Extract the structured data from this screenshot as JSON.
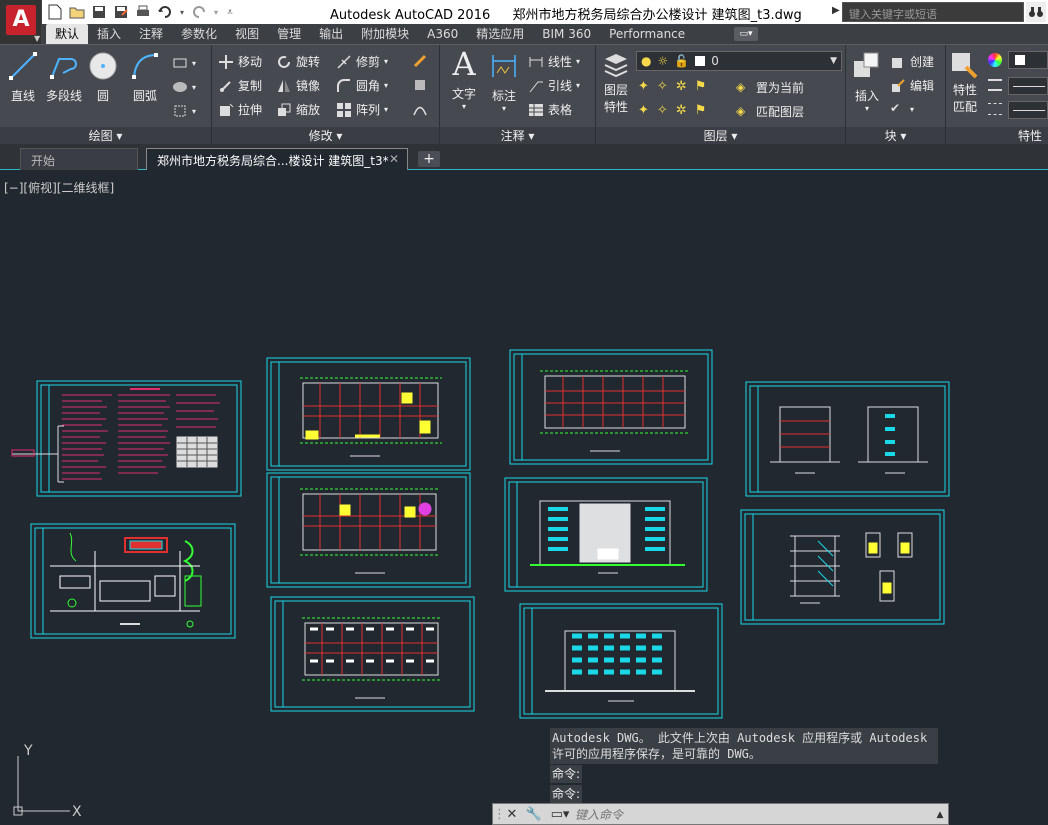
{
  "title_bar": {
    "app_title": "Autodesk AutoCAD 2016",
    "file_title": "郑州市地方税务局综合办公楼设计 建筑图_t3.dwg",
    "search_placeholder": "键入关键字或短语"
  },
  "ribbon_tabs": [
    "默认",
    "插入",
    "注释",
    "参数化",
    "视图",
    "管理",
    "输出",
    "附加模块",
    "A360",
    "精选应用",
    "BIM 360",
    "Performance"
  ],
  "active_tab": "默认",
  "panels": {
    "draw": {
      "title": "绘图",
      "tools": [
        "直线",
        "多段线",
        "圆",
        "圆弧"
      ]
    },
    "modify": {
      "title": "修改",
      "tools": [
        "移动",
        "旋转",
        "修剪",
        "复制",
        "镜像",
        "圆角",
        "拉伸",
        "缩放",
        "阵列"
      ]
    },
    "annotation": {
      "title": "注释",
      "big_tools": [
        "文字",
        "标注"
      ],
      "small_tools": [
        "线性",
        "引线",
        "表格"
      ]
    },
    "layers": {
      "title": "图层",
      "big_tool": "图层特性",
      "big_tool_line1": "图层",
      "big_tool_line2": "特性",
      "layer_current": "0",
      "actions": [
        "置为当前",
        "匹配图层"
      ]
    },
    "block": {
      "title": "块",
      "big_tool": "插入",
      "actions": [
        "创建",
        "编辑"
      ]
    },
    "properties": {
      "title": "特性",
      "big_tool_line1": "特性",
      "big_tool_line2": "匹配"
    }
  },
  "doc_tabs": {
    "start": "开始",
    "active": "郑州市地方税务局综合...楼设计 建筑图_t3*"
  },
  "viewport": {
    "label": "[−][俯视][二维线框]"
  },
  "ucs": {
    "y_label": "Y",
    "x_label": "X"
  },
  "command": {
    "history_line1": "Autodesk DWG。  此文件上次由 Autodesk 应用程序或 Autodesk",
    "history_line2": "许可的应用程序保存，是可靠的 DWG。",
    "prompt1": "命令:",
    "prompt2": "命令:",
    "input_placeholder": "键入命令"
  },
  "colors": {
    "sheet_border": "#19d8e8",
    "background": "#212830",
    "ribbon": "#464a50"
  }
}
